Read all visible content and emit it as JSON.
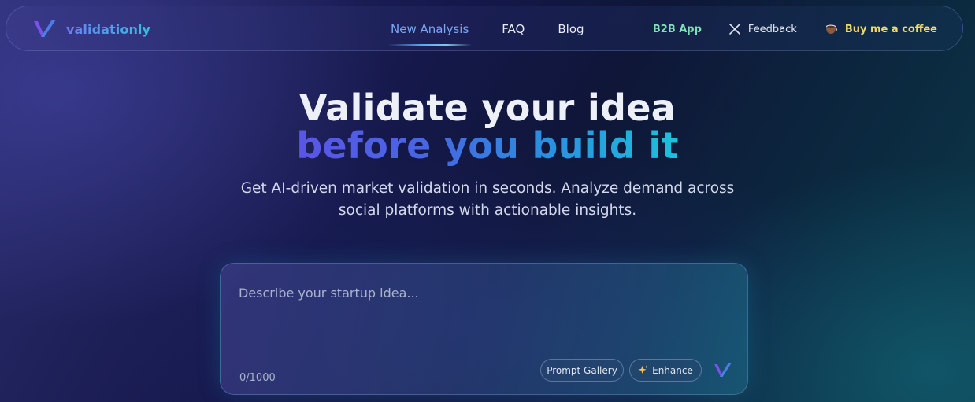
{
  "navbar": {
    "brand_name": "validationly",
    "links": [
      {
        "label": "New Analysis",
        "active": true
      },
      {
        "label": "FAQ",
        "active": false
      },
      {
        "label": "Blog",
        "active": false
      }
    ],
    "b2b_label": "B2B App",
    "feedback_label": "Feedback",
    "coffee_label": "Buy me a coffee",
    "icons": {
      "brand": "validationly-v-logo-icon",
      "feedback": "x-close-icon",
      "coffee": "coffee-cup-icon"
    }
  },
  "hero": {
    "title_line1": "Validate your idea",
    "title_line2": "before you build it",
    "subtitle": "Get AI-driven market validation in seconds. Analyze demand across social platforms with actionable insights."
  },
  "idea_box": {
    "placeholder": "Describe your startup idea...",
    "value": "",
    "char_count": "0/1000",
    "prompt_gallery_label": "Prompt Gallery",
    "enhance_label": "Enhance",
    "icons": {
      "enhance": "sparkles-icon",
      "submit": "validationly-v-logo-icon"
    }
  },
  "colors": {
    "accent_blue": "#7aa6f5",
    "b2b_green": "#7fe0b6",
    "coffee_yellow": "#f3d86a",
    "gradient_start": "#5a55e6",
    "gradient_end": "#1cc2dc"
  }
}
